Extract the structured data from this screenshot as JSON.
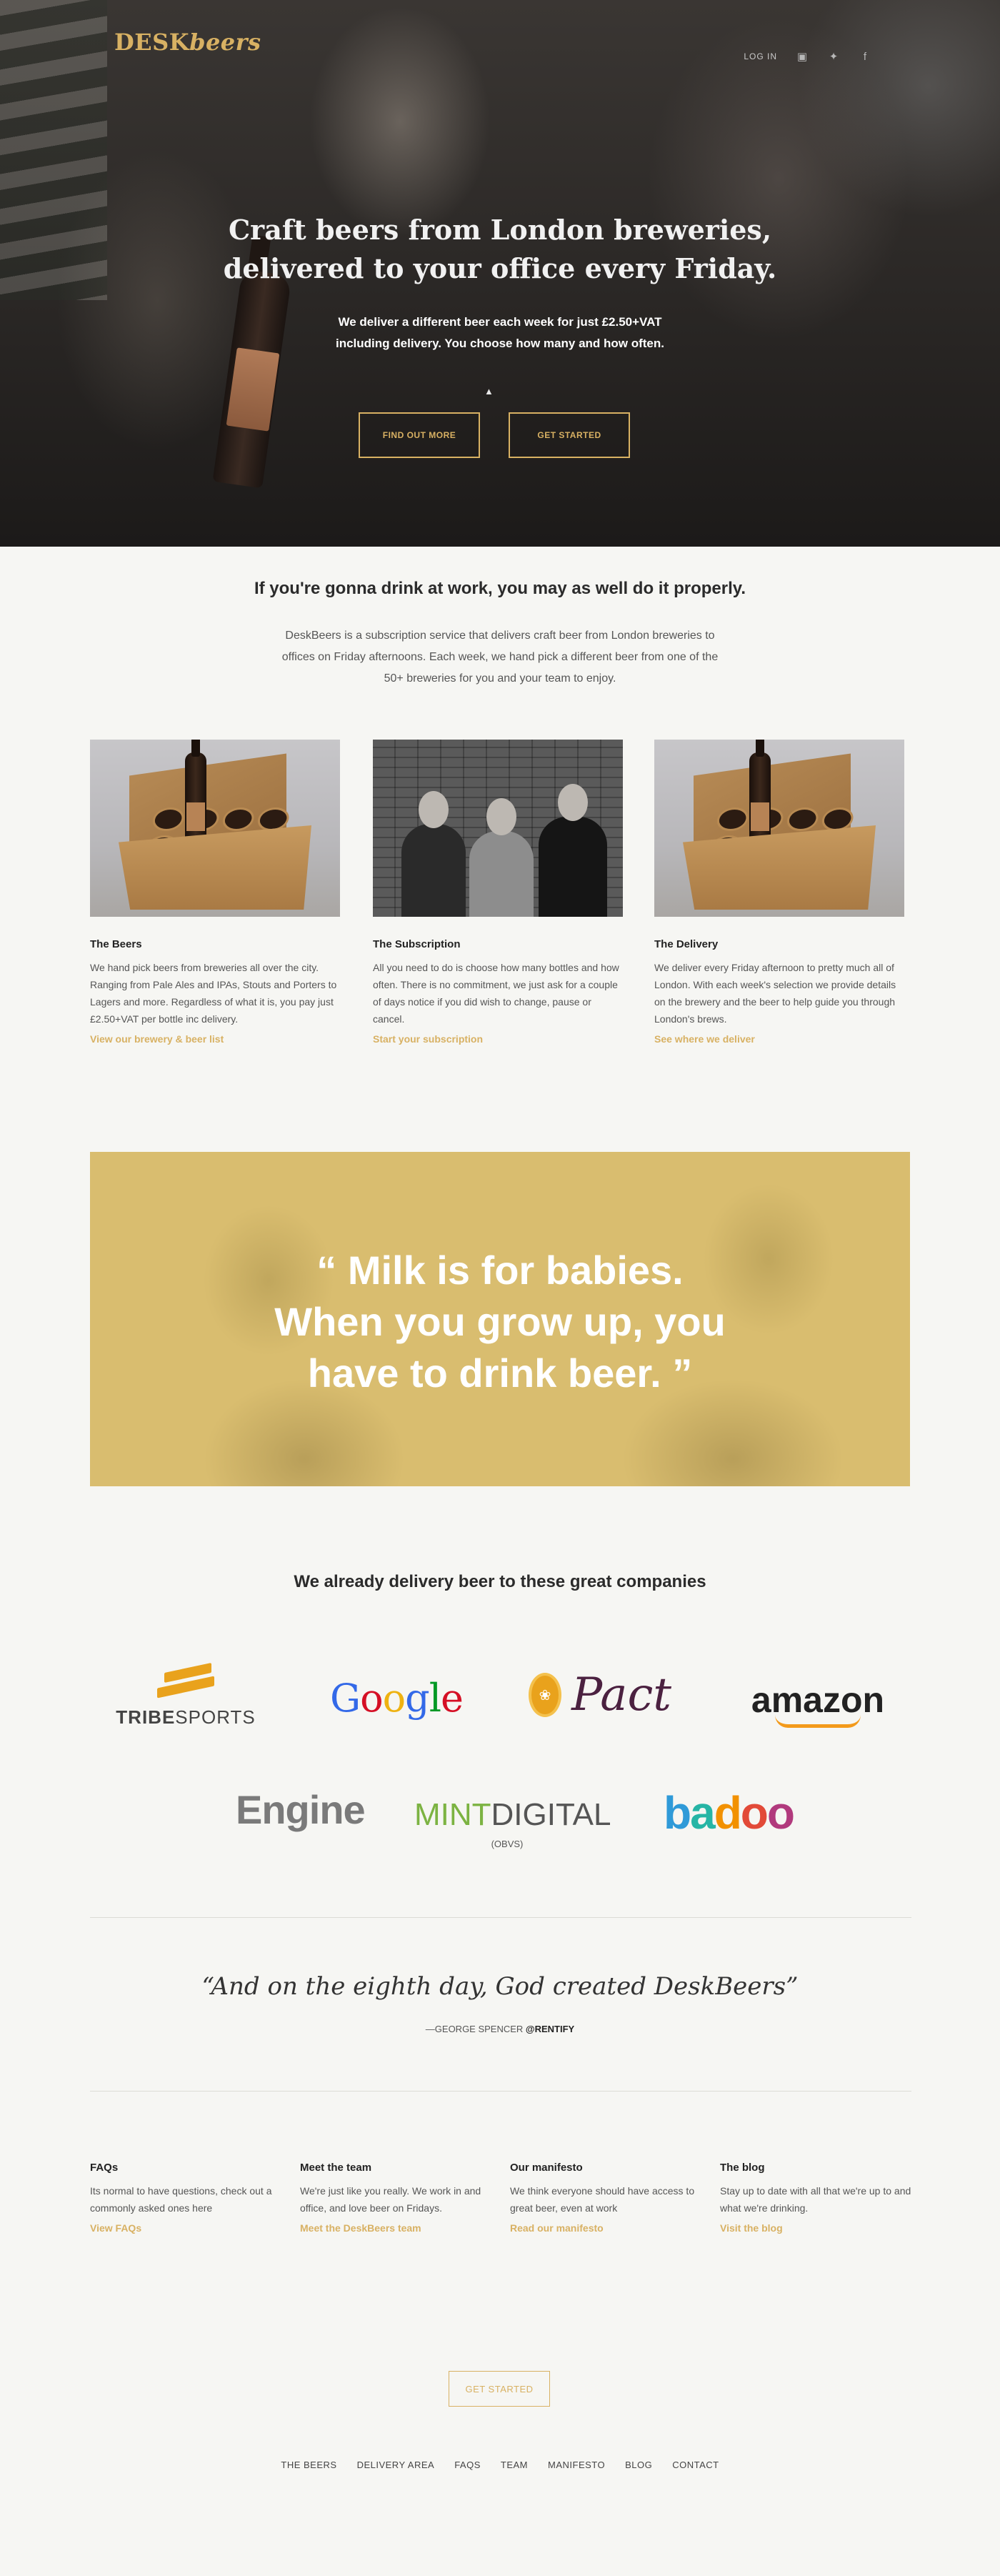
{
  "header": {
    "logo_part1": "DESK",
    "logo_part2": "beers",
    "login": "LOG IN",
    "social_icons": [
      "instagram-icon",
      "twitter-icon",
      "facebook-icon"
    ]
  },
  "hero": {
    "title_line1": "Craft beers from London breweries,",
    "title_line2": "delivered to your office every Friday.",
    "subtitle_line1": "We deliver a different beer each week for just £2.50+VAT",
    "subtitle_line2": "including delivery. You choose how many and how often.",
    "buttons": {
      "find_out_more": "FIND OUT MORE",
      "get_started": "GET STARTED"
    }
  },
  "intro": {
    "title": "If you're gonna drink at work, you may as well do it properly.",
    "text": "DeskBeers is a subscription service that delivers craft beer from London breweries to offices on Friday afternoons. Each week, we hand pick a different beer from one of the 50+ breweries for you and your team to enjoy."
  },
  "features": [
    {
      "title": "The Beers",
      "text": "We hand pick beers from breweries all over the city. Ranging from Pale Ales and IPAs, Stouts and Porters to Lagers and more. Regardless of what it is, you pay just £2.50+VAT per bottle inc delivery.",
      "link": "View our brewery & beer list"
    },
    {
      "title": "The Subscription",
      "text": "All you need to do is choose how many bottles and how often. There is no commitment, we just ask for a couple of days notice if you did wish to change, pause or cancel.",
      "link": "Start your subscription"
    },
    {
      "title": "The Delivery",
      "text": "We deliver every Friday afternoon to pretty much all of London. With each week's selection we provide details on the brewery and the beer to help guide you through London's brews.",
      "link": "See where we deliver"
    }
  ],
  "banner": {
    "quote_line1": "“ Milk is for babies.",
    "quote_line2": "When you grow up, you",
    "quote_line3": "have to drink beer. ”"
  },
  "companies": {
    "title": "We already delivery beer to these great companies",
    "logos": {
      "tribe_a": "TRIBE",
      "tribe_b": "SPORTS",
      "google": [
        "G",
        "o",
        "o",
        "g",
        "l",
        "e"
      ],
      "pact": "Pact",
      "amazon": "amazon",
      "engine": "Engine",
      "mint_a": "MINT",
      "mint_b": "DIGITAL",
      "mint_sub": "(OBVS)",
      "badoo": [
        "b",
        "a",
        "d",
        "o",
        "o"
      ]
    },
    "colors": {
      "google": [
        "#3369e8",
        "#d50f25",
        "#eeb211",
        "#3369e8",
        "#009925",
        "#d50f25"
      ],
      "accent": "#d8b163"
    }
  },
  "testimonial": {
    "quote": "“And on the eighth day, God created DeskBeers”",
    "author_prefix": "—GEORGE SPENCER ",
    "author_handle": "@RENTIFY"
  },
  "links": [
    {
      "title": "FAQs",
      "text": "Its normal to have questions, check out a commonly asked ones here",
      "link": "View FAQs"
    },
    {
      "title": "Meet the team",
      "text": "We're just like you really. We work in and office, and love beer on Fridays.",
      "link": "Meet the DeskBeers team"
    },
    {
      "title": "Our manifesto",
      "text": "We think everyone should have access to great beer, even at work",
      "link": "Read our manifesto"
    },
    {
      "title": "The blog",
      "text": "Stay up to date with all that we're up to  and what we're drinking.",
      "link": "Visit the blog"
    }
  ],
  "cta": "GET STARTED",
  "footer": [
    "THE BEERS",
    "DELIVERY AREA",
    "FAQS",
    "TEAM",
    "MANIFESTO",
    "BLOG",
    "CONTACT"
  ]
}
